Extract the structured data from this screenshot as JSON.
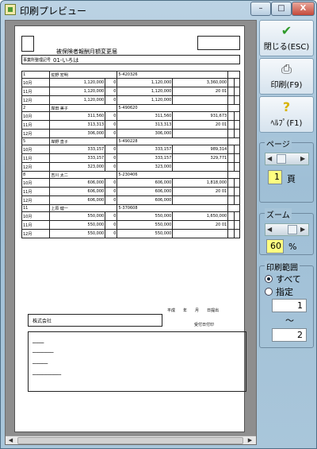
{
  "window": {
    "title": "印刷プレビュー",
    "min": "–",
    "max": "□",
    "close": "X"
  },
  "side": {
    "close_label": "閉じる(ESC)",
    "print_label": "印刷(F9)",
    "help_label": "ﾍﾙﾌﾟ(F1)",
    "page": {
      "title": "ページ",
      "value": "1",
      "unit": "頁"
    },
    "zoom": {
      "title": "ズーム",
      "value": "60",
      "unit": "%"
    },
    "range": {
      "title": "印刷範囲",
      "all": "すべて",
      "specify": "指定",
      "from": "1",
      "tilde": "～",
      "to": "2"
    }
  },
  "icons": {
    "close": "check-icon",
    "print": "printer-icon",
    "help": "help-icon"
  },
  "form": {
    "title": "被保険者報酬月額変更届",
    "office_label": "事業所整理記号",
    "office_value": "01-いろは",
    "rows": [
      {
        "no": "1",
        "name": "佐野 宏明",
        "date": "5-420326",
        "m1": "10月",
        "m2": "11月",
        "m3": "12月",
        "a1": "1,120,000",
        "a2": "1,120,000",
        "a3": "1,120,000",
        "b1": "0",
        "b2": "0",
        "b3": "0",
        "c1": "1,120,000",
        "c2": "1,120,000",
        "c3": "1,120,000",
        "old": "3,360,000",
        "new": "20 01"
      },
      {
        "no": "2",
        "name": "岸田 美子",
        "date": "5-490620",
        "m1": "10月",
        "m2": "11月",
        "m3": "12月",
        "a1": "311,560",
        "a2": "313,313",
        "a3": "306,000",
        "b1": "0",
        "b2": "0",
        "b3": "0",
        "c1": "311,560",
        "c2": "313,313",
        "c3": "306,000",
        "old": "931,673",
        "new": "20 01"
      },
      {
        "no": "5",
        "name": "岸野 直子",
        "date": "5-490228",
        "m1": "10月",
        "m2": "11月",
        "m3": "12月",
        "a1": "333,157",
        "a2": "333,157",
        "a3": "323,000",
        "b1": "0",
        "b2": "0",
        "b3": "0",
        "c1": "333,157",
        "c2": "333,157",
        "c3": "323,000",
        "old": "989,314",
        "new": "329,771"
      },
      {
        "no": "8",
        "name": "吉川 太二",
        "date": "5-230406",
        "m1": "10月",
        "m2": "11月",
        "m3": "12月",
        "a1": "606,000",
        "a2": "606,000",
        "a3": "606,000",
        "b1": "0",
        "b2": "0",
        "b3": "0",
        "c1": "606,000",
        "c2": "606,000",
        "c3": "606,000",
        "old": "1,818,000",
        "new": "20 01"
      },
      {
        "no": "11",
        "name": "上原 健一",
        "date": "5-370608",
        "m1": "10月",
        "m2": "11月",
        "m3": "12月",
        "a1": "550,000",
        "a2": "550,000",
        "a3": "550,000",
        "b1": "0",
        "b2": "0",
        "b3": "0",
        "c1": "550,000",
        "c2": "550,000",
        "c3": "550,000",
        "old": "1,650,000",
        "new": "20 01"
      }
    ],
    "company": "株式会社",
    "date_label": "平成　　年　　月　　日提出",
    "stamp": "受付日付印"
  }
}
